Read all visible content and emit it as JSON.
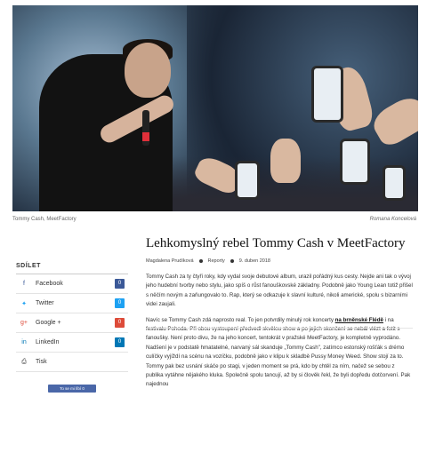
{
  "caption": {
    "left": "Tommy Cash, MeetFactory",
    "right": "Romana Koncelová"
  },
  "share": {
    "title": "SDÍLET",
    "items": [
      {
        "label": "Facebook",
        "icon": "facebook-icon",
        "glyph": "f",
        "count": "0",
        "color": "#3b5998"
      },
      {
        "label": "Twitter",
        "icon": "twitter-icon",
        "glyph": "✦",
        "count": "0",
        "color": "#1da1f2"
      },
      {
        "label": "Google +",
        "icon": "google-plus-icon",
        "glyph": "g+",
        "count": "0",
        "color": "#dd4b39"
      },
      {
        "label": "LinkedIn",
        "icon": "linkedin-icon",
        "glyph": "in",
        "count": "0",
        "color": "#0077b5"
      },
      {
        "label": "Tisk",
        "icon": "print-icon",
        "glyph": "⎙",
        "count": "",
        "color": ""
      }
    ],
    "button": "To se mi líbí 0"
  },
  "article": {
    "title": "Lehkomyslný rebel Tommy Cash v MeetFactory",
    "meta": {
      "author": "Magdalena Prudíková",
      "category": "Reporty",
      "date": "9. duben 2018"
    },
    "paragraph1": "Tommy Cash za ty čtyři roky, kdy vydal svoje debutové album, urazil pořádný kus cesty. Nejde ani tak o vývoj jeho hudební tvorby nebo stylu, jako spíš o růst fanouškovské základny. Podobně jako Young Lean totiž přišel s něčím novým a zaňungovalo to. Rap, který se odkazuje k slavní kulturé, nikoli americké, spolu s bizarními videi zaujali.",
    "paragraph2_before": "Navíc se Tommy Cash zdá naprosto real. To jen potvrdily minulý rok koncerty ",
    "paragraph2_link": "na brněnské Flédě",
    "paragraph2_after": " i na festivalu Pohoda. Při obou vystoupení předvedl skvělou show a po jejich skončení se nebál vlézt a fotit s fanoušky. Není proto divu, že na jeho koncert, tentokrát v pražské MeetFactory, je kompletně vyprodáno. Nadšení je v podstatě hmatatelné, narvaný sál skanduje „Tommy Cash\", zatímco estonský rošťák s drémo culíčky vyjíždí na scénu na vozíčku, podobně jako v klipu k skladbě Pussy Money Weed. Show stojí za to. Tommy pak bez usnání skáče po stagi, v jeden moment se prá, kdo by chtěl za ním, načež se sebou z publika vytáhne nějakého kluka. Společně spolu tancují, až by si člověk řekl, že byli dopředu dotčorvení. Pak najednou"
  }
}
